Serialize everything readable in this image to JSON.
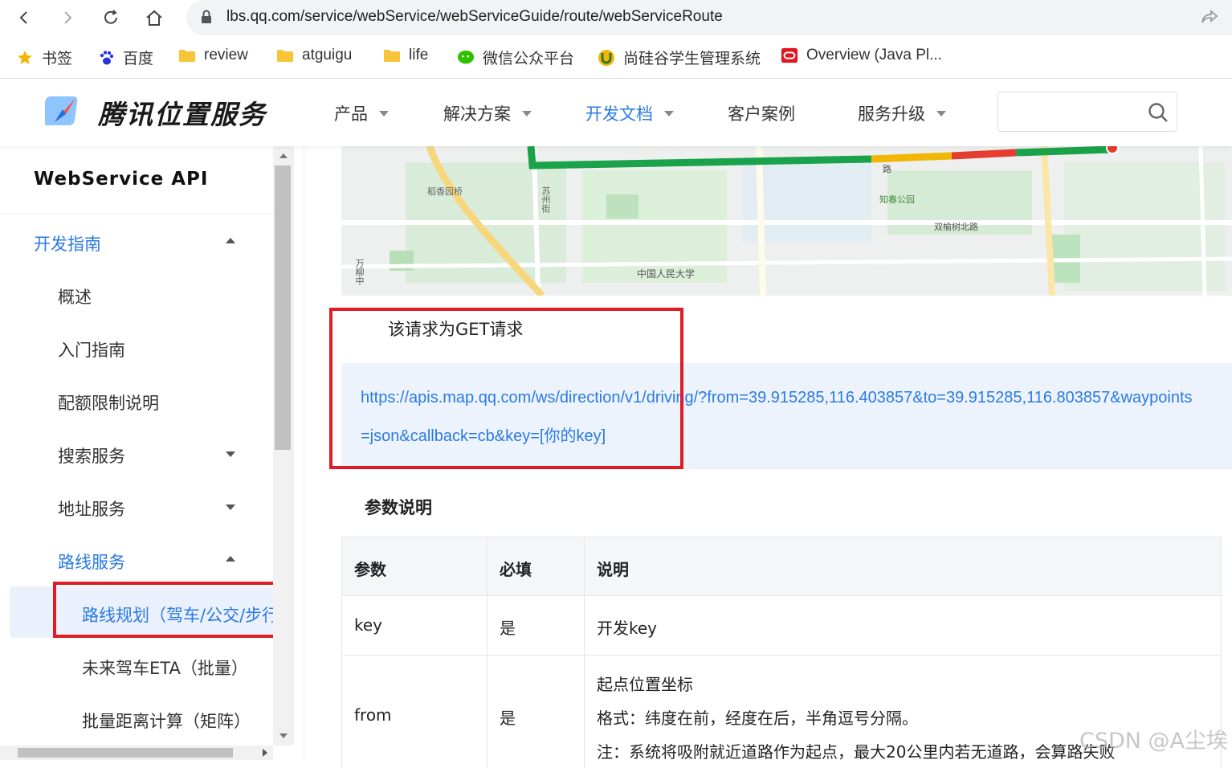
{
  "browser": {
    "url": "lbs.qq.com/service/webService/webServiceGuide/route/webServiceRoute",
    "bookmarks": [
      {
        "label": "书签",
        "icon": "star-icon"
      },
      {
        "label": "百度",
        "icon": "baidu-paw-icon"
      },
      {
        "label": "review",
        "icon": "folder-icon"
      },
      {
        "label": "atguigu",
        "icon": "folder-icon"
      },
      {
        "label": "life",
        "icon": "folder-icon"
      },
      {
        "label": "微信公众平台",
        "icon": "wechat-icon"
      },
      {
        "label": "尚硅谷学生管理系统",
        "icon": "shield-logo-icon"
      },
      {
        "label": "Overview (Java Pl...",
        "icon": "oracle-icon"
      }
    ]
  },
  "site": {
    "logo_text": "腾讯位置服务",
    "nav": [
      {
        "label": "产品",
        "has_dropdown": true
      },
      {
        "label": "解决方案",
        "has_dropdown": true
      },
      {
        "label": "开发文档",
        "has_dropdown": true,
        "active": true
      },
      {
        "label": "客户案例",
        "has_dropdown": false
      },
      {
        "label": "服务升级",
        "has_dropdown": true
      }
    ],
    "search_placeholder": ""
  },
  "sidebar": {
    "title": "WebService API",
    "items": [
      {
        "label": "开发指南",
        "state": "expanded"
      },
      {
        "label": "概述"
      },
      {
        "label": "入门指南"
      },
      {
        "label": "配额限制说明"
      },
      {
        "label": "搜索服务",
        "state": "collapsed"
      },
      {
        "label": "地址服务",
        "state": "collapsed"
      },
      {
        "label": "路线服务",
        "state": "expanded"
      },
      {
        "label": "路线规划（驾车/公交/步行",
        "selected": true
      },
      {
        "label": "未来驾车ETA（批量）"
      },
      {
        "label": "批量距离计算（矩阵）"
      }
    ]
  },
  "map": {
    "labels": [
      "稻香园桥",
      "苏州街",
      "知春公园",
      "双榆树北路",
      "中国人民大学",
      "万柳中",
      "路"
    ]
  },
  "content": {
    "request_note": "该请求为GET请求",
    "example_url_line1": "https://apis.map.qq.com/ws/direction/v1/driving/?from=39.915285,116.403857&to=39.915285,116.803857&waypoints",
    "example_url_line2": "=json&callback=cb&key=[你的key]",
    "param_title": "参数说明",
    "table": {
      "headers": [
        "参数",
        "必填",
        "说明"
      ],
      "rows": [
        {
          "param": "key",
          "required": "是",
          "desc": [
            "开发key"
          ]
        },
        {
          "param": "from",
          "required": "是",
          "desc": [
            "起点位置坐标",
            "格式：纬度在前，经度在后，半角逗号分隔。",
            "注：系统将吸附就近道路作为起点，最大20公里内若无道路，会算路失败"
          ]
        }
      ]
    }
  },
  "watermark": "CSDN @A尘埃",
  "colors": {
    "accent": "#2a7ae2",
    "highlight_box": "#e01b24",
    "route_green": "#1aa34a"
  }
}
